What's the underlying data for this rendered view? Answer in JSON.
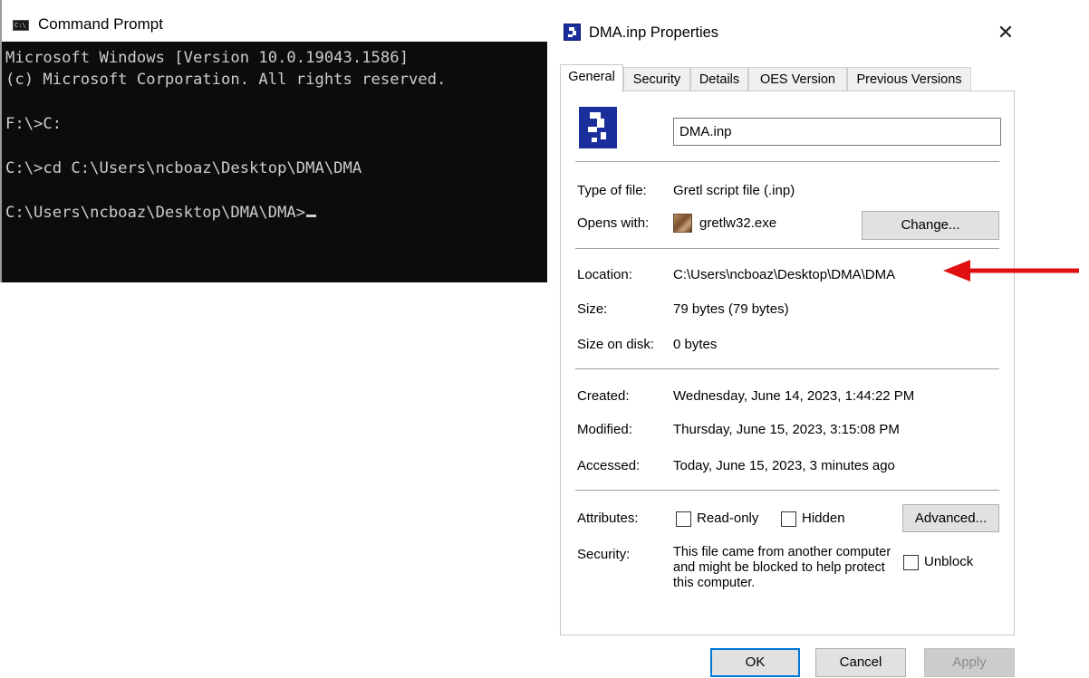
{
  "cmd": {
    "title": "Command Prompt",
    "lines": [
      "Microsoft Windows [Version 10.0.19043.1586]",
      "(c) Microsoft Corporation. All rights reserved.",
      "F:\\>C:",
      "C:\\>cd C:\\Users\\ncboaz\\Desktop\\DMA\\DMA",
      "C:\\Users\\ncboaz\\Desktop\\DMA\\DMA>"
    ]
  },
  "dialog": {
    "title": "DMA.inp Properties",
    "close_glyph": "✕",
    "tabs": [
      "General",
      "Security",
      "Details",
      "OES Version",
      "Previous Versions"
    ],
    "filename": "DMA.inp",
    "type_of_file_label": "Type of file:",
    "type_of_file": "Gretl script file (.inp)",
    "opens_with_label": "Opens with:",
    "opens_with": "gretlw32.exe",
    "change_button": "Change...",
    "location_label": "Location:",
    "location": "C:\\Users\\ncboaz\\Desktop\\DMA\\DMA",
    "size_label": "Size:",
    "size": "79 bytes (79 bytes)",
    "size_on_disk_label": "Size on disk:",
    "size_on_disk": "0 bytes",
    "created_label": "Created:",
    "created": "Wednesday, June 14, 2023, 1:44:22 PM",
    "modified_label": "Modified:",
    "modified": "Thursday, June 15, 2023, 3:15:08 PM",
    "accessed_label": "Accessed:",
    "accessed": "Today, June 15, 2023, 3 minutes ago",
    "attributes_label": "Attributes:",
    "readonly_label": "Read-only",
    "hidden_label": "Hidden",
    "advanced_button": "Advanced...",
    "security_label": "Security:",
    "security_text": "This file came from another computer and might be blocked to help protect this computer.",
    "unblock_label": "Unblock",
    "ok_button": "OK",
    "cancel_button": "Cancel",
    "apply_button": "Apply"
  },
  "colors": {
    "cmd_background": "#0c0c0c",
    "cmd_text": "#cccccc",
    "arrow": "#e01010",
    "ok_border": "#0078d7"
  },
  "icons": [
    "cmd-app-icon",
    "file-icon",
    "gretl-app-icon",
    "close-icon",
    "red-arrow-annotation"
  ]
}
